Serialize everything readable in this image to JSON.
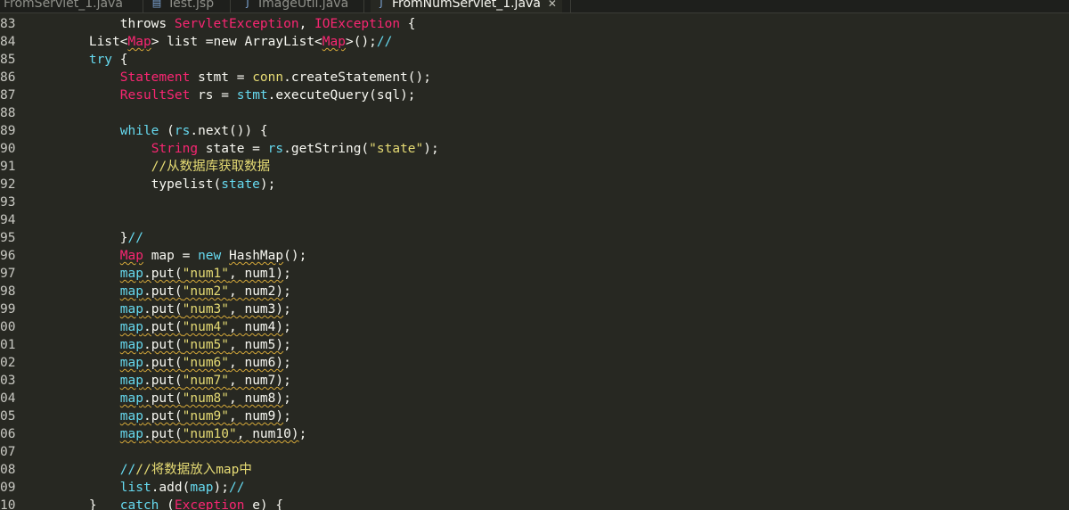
{
  "tabs": [
    {
      "label": "FromServlet_1.java",
      "icon": "java-file-icon",
      "active": false
    },
    {
      "label": "Test.jsp",
      "icon": "jsp-file-icon",
      "active": false
    },
    {
      "label": "ImageUtil.java",
      "icon": "java-file-icon",
      "active": false
    },
    {
      "label": "FromNumServlet_1.java",
      "icon": "java-file-icon",
      "active": true,
      "close": "✕"
    }
  ],
  "editor": {
    "line_numbers": [
      "83",
      "84",
      "85",
      "86",
      "87",
      "88",
      "89",
      "90",
      "91",
      "92",
      "93",
      "94",
      "95",
      "96",
      "97",
      "98",
      "99",
      "00",
      "01",
      "02",
      "03",
      "04",
      "05",
      "06",
      "07",
      "08",
      "09",
      "10"
    ],
    "comment_1": "//从数据库获取数据",
    "comment_2": "//将数据放入map中",
    "sql_var": "sql",
    "state_key": "\"state\"",
    "map_entries": [
      {
        "key": "\"num1\"",
        "val": "num1"
      },
      {
        "key": "\"num2\"",
        "val": "num2"
      },
      {
        "key": "\"num3\"",
        "val": "num3"
      },
      {
        "key": "\"num4\"",
        "val": "num4"
      },
      {
        "key": "\"num5\"",
        "val": "num5"
      },
      {
        "key": "\"num6\"",
        "val": "num6"
      },
      {
        "key": "\"num7\"",
        "val": "num7"
      },
      {
        "key": "\"num8\"",
        "val": "num8"
      },
      {
        "key": "\"num9\"",
        "val": "num9"
      },
      {
        "key": "\"num10\"",
        "val": "num10"
      }
    ]
  },
  "colors": {
    "background": "#272822",
    "keyword": "#66d9ef",
    "string": "#e6db74",
    "type": "#f92672"
  }
}
